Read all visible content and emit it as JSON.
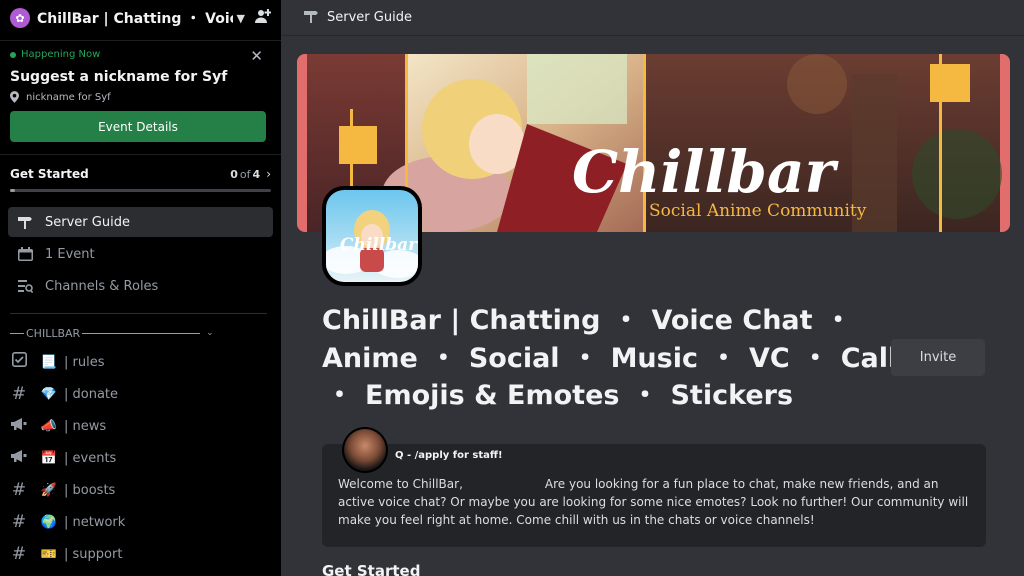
{
  "server": {
    "name": "ChillBar | Chatting ・ Voic...",
    "icon": "server-badge-icon"
  },
  "event": {
    "status": "Happening Now",
    "title": "Suggest a nickname for Syf",
    "location": "nickname for Syf",
    "button": "Event Details"
  },
  "get_started": {
    "label": "Get Started",
    "done": "0",
    "of": "of",
    "total": "4",
    "progress": 0.02
  },
  "nav": [
    {
      "label": "Server Guide",
      "icon": "signpost-icon"
    },
    {
      "label": "1 Event",
      "icon": "calendar-icon"
    },
    {
      "label": "Channels & Roles",
      "icon": "channels-roles-icon"
    }
  ],
  "category": {
    "label": "CHILLBAR"
  },
  "channels": [
    {
      "label": "| rules",
      "kind": "rules",
      "emoji": "📃"
    },
    {
      "label": "| donate",
      "kind": "#",
      "emoji": "💎"
    },
    {
      "label": "| news",
      "kind": "announce",
      "emoji": "📣"
    },
    {
      "label": "| events",
      "kind": "announce",
      "emoji": "📅"
    },
    {
      "label": "| boosts",
      "kind": "#",
      "emoji": "🚀"
    },
    {
      "label": "| network",
      "kind": "#",
      "emoji": "🌍"
    },
    {
      "label": "| support",
      "kind": "#",
      "emoji": "🎫"
    }
  ],
  "topbar": {
    "title": "Server Guide"
  },
  "banner": {
    "logo": "Chillbar",
    "tagline": "Social Anime Community",
    "avatar_text": "Chillbar"
  },
  "title": {
    "line1_a": "ChillBar | Chatting",
    "line1_sep": "・",
    "line1_b": "Voice Chat",
    "line1_tail": "・",
    "line2_a": "Anime",
    "line2_b": "Social",
    "line2_c": "Music",
    "line2_d": "VC",
    "line2_e": "Call",
    "line3_a": "Emojis & Emotes",
    "line3_b": "Stickers",
    "sep": "・"
  },
  "invite": {
    "label": "Invite"
  },
  "welcome": {
    "author": "Q - /apply for staff!",
    "text_a": "Welcome to ChillBar,",
    "text_b": "Are you looking for a fun place to chat, make new friends, and an active voice chat? Or maybe you are looking for some nice emotes? Look no further! Our community will make you feel right at home. Come chill with us in the chats or voice channels!"
  },
  "section": {
    "get_started": "Get Started"
  },
  "colors": {
    "accent_green": "#248046",
    "bg": "#313338",
    "sidebar": "#000000"
  }
}
